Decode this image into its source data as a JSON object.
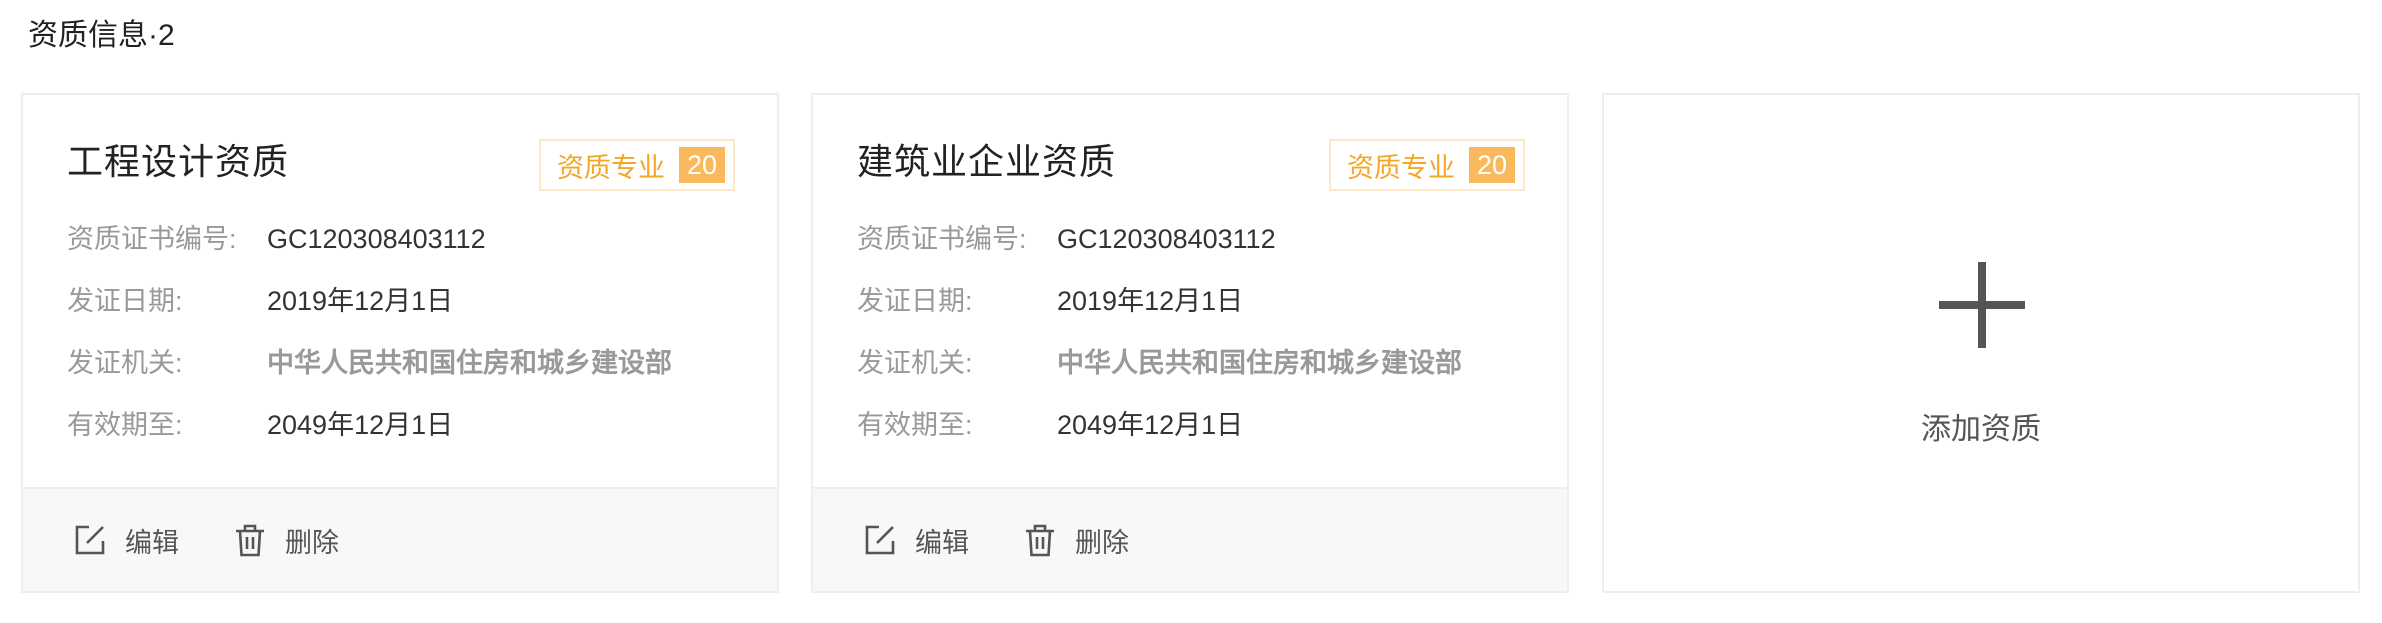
{
  "section": {
    "title": "资质信息·2"
  },
  "cards": [
    {
      "title": "工程设计资质",
      "badge_label": "资质专业",
      "badge_count": "20",
      "fields": [
        {
          "label": "资质证书编号:",
          "value": "GC120308403112"
        },
        {
          "label": "发证日期:",
          "value": "2019年12月1日"
        },
        {
          "label": "发证机关:",
          "value": "中华人民共和国住房和城乡建设部"
        },
        {
          "label": "有效期至:",
          "value": "2049年12月1日"
        }
      ],
      "actions": {
        "edit_label": "编辑",
        "delete_label": "删除"
      }
    },
    {
      "title": "建筑业企业资质",
      "badge_label": "资质专业",
      "badge_count": "20",
      "fields": [
        {
          "label": "资质证书编号:",
          "value": "GC120308403112"
        },
        {
          "label": "发证日期:",
          "value": "2019年12月1日"
        },
        {
          "label": "发证机关:",
          "value": "中华人民共和国住房和城乡建设部"
        },
        {
          "label": "有效期至:",
          "value": "2049年12月1日"
        }
      ],
      "actions": {
        "edit_label": "编辑",
        "delete_label": "删除"
      }
    }
  ],
  "add_card": {
    "label": "添加资质",
    "icon": "plus-icon"
  },
  "icons": {
    "edit": "edit-icon",
    "delete": "trash-icon"
  },
  "colors": {
    "badge_text": "#f5a623",
    "badge_fill": "#f9b95c",
    "badge_border": "#fde7c6",
    "footer_bg": "#f7f8fa",
    "card_border": "#eeeeee"
  }
}
